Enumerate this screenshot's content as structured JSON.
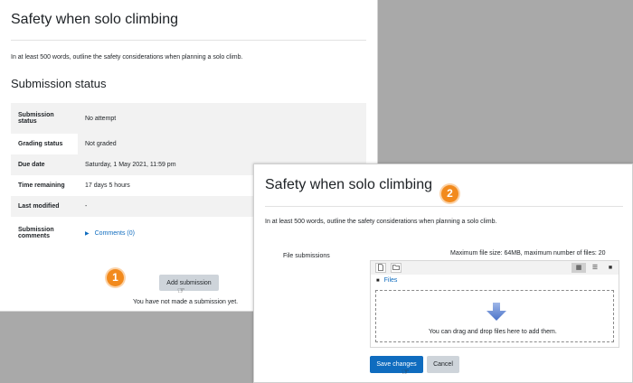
{
  "left_panel": {
    "title": "Safety when solo climbing",
    "intro": "In at least 500 words, outline the safety considerations when planning a solo climb.",
    "submission_heading": "Submission status",
    "rows": [
      {
        "label": "Submission status",
        "value": "No attempt"
      },
      {
        "label": "Grading status",
        "value": "Not graded"
      },
      {
        "label": "Due date",
        "value": "Saturday, 1 May 2021, 11:59 pm"
      },
      {
        "label": "Time remaining",
        "value": "17 days 5 hours"
      },
      {
        "label": "Last modified",
        "value": "-"
      },
      {
        "label": "Submission comments",
        "value": "Comments (0)"
      }
    ],
    "badge": "1",
    "add_submission": "Add submission",
    "no_submission_text": "You have not made a submission yet."
  },
  "right_panel": {
    "title": "Safety when solo climbing",
    "badge": "2",
    "intro": "In at least 500 words, outline the safety considerations when planning a solo climb.",
    "file_label": "File submissions",
    "limits": "Maximum file size: 64MB, maximum number of files: 20",
    "files_link": "Files",
    "drop_text": "You can drag and drop files here to add them.",
    "save_button": "Save changes",
    "cancel_button": "Cancel"
  },
  "colors": {
    "accent": "#0f6cbf",
    "badge": "#f28a1d",
    "backdrop": "#a9a9a9"
  },
  "icons": [
    "add-file-icon",
    "create-folder-icon",
    "grid-view-icon",
    "list-view-icon",
    "folder-view-icon",
    "folder-icon",
    "triangle-right-icon",
    "down-arrow-icon",
    "hand-cursor-icon"
  ]
}
